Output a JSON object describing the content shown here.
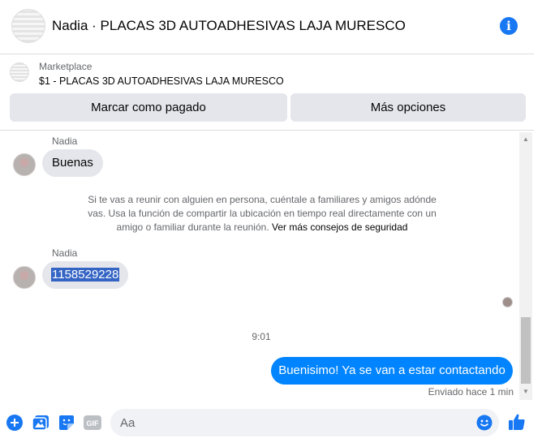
{
  "header": {
    "title": "Nadia · PLACAS 3D AUTOADHESIVAS LAJA MURESCO",
    "info_icon": "info-icon"
  },
  "marketplace": {
    "label": "Marketplace",
    "item": "$1 - PLACAS 3D AUTOADHESIVAS LAJA MURESCO",
    "buttons": {
      "mark_paid": "Marcar como pagado",
      "more_options": "Más opciones"
    }
  },
  "messages": {
    "first": {
      "sender": "Nadia",
      "text": "Buenas"
    },
    "safety": {
      "text": "Si te vas a reunir con alguien en persona, cuéntale a familiares y amigos adónde vas. Usa la función de compartir la ubicación en tiempo real directamente con un amigo o familiar durante la reunión.",
      "link": "Ver más consejos de seguridad"
    },
    "second": {
      "sender": "Nadia",
      "text": "1158529228"
    },
    "time": "9:01",
    "outgoing": {
      "text": "Buenisimo! Ya se van a estar contactando",
      "status": "Enviado hace 1 min"
    }
  },
  "composer": {
    "placeholder": "Aa",
    "icons": [
      "plus-circle-icon",
      "photo-icon",
      "sticker-icon",
      "gif-icon",
      "emoji-icon",
      "like-icon"
    ],
    "gif_label": "GIF"
  },
  "colors": {
    "accent": "#1877f2",
    "outgoing_bubble": "#0084ff",
    "incoming_bubble": "#e4e6eb"
  }
}
